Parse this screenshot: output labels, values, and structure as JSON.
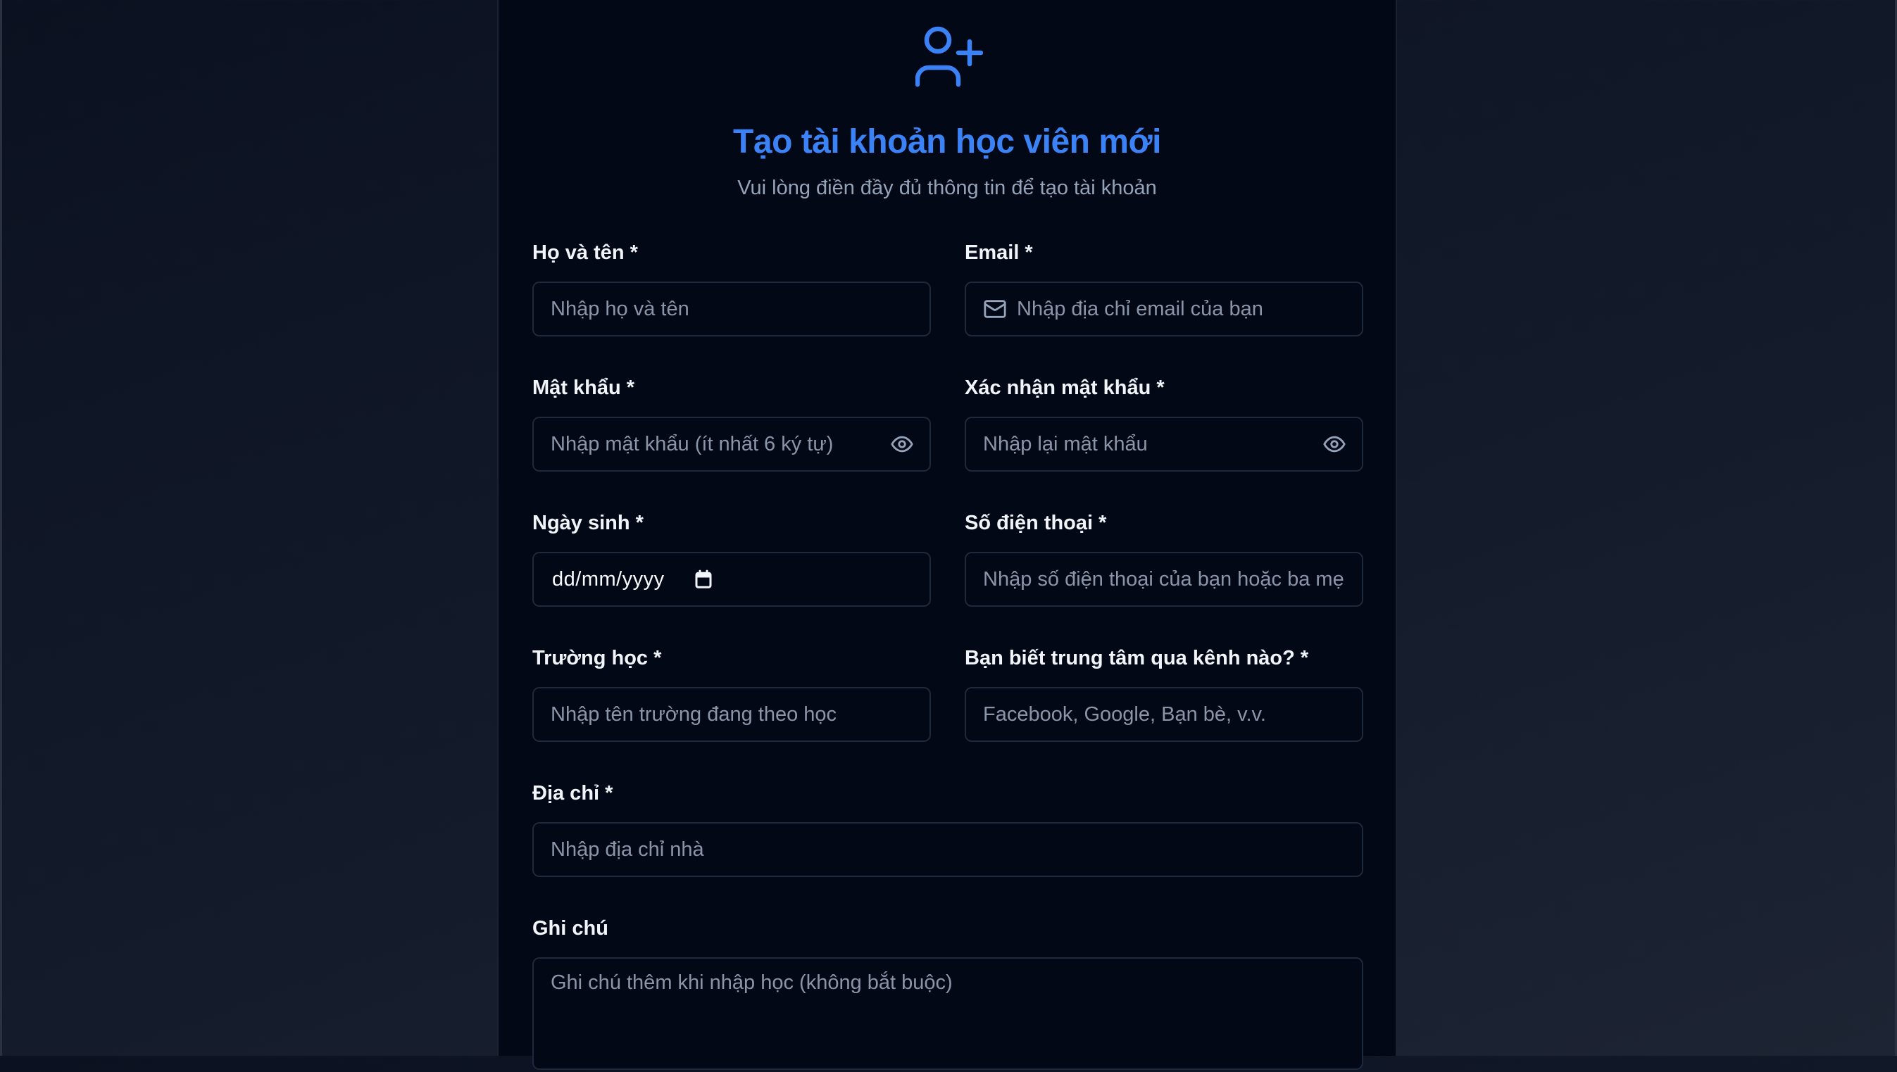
{
  "form": {
    "title": "Tạo tài khoản học viên mới",
    "subtitle": "Vui lòng điền đầy đủ thông tin để tạo tài khoản",
    "header_icon": "user-plus-icon",
    "accent_color": "#3b82f6",
    "fields": {
      "full_name": {
        "label": "Họ và tên *",
        "placeholder": "Nhập họ và tên",
        "value": ""
      },
      "email": {
        "label": "Email *",
        "placeholder": "Nhập địa chỉ email của bạn",
        "value": "",
        "icon": "mail-icon"
      },
      "password": {
        "label": "Mật khẩu *",
        "placeholder": "Nhập mật khẩu (ít nhất 6 ký tự)",
        "value": "",
        "icon": "eye-icon"
      },
      "confirm_password": {
        "label": "Xác nhận mật khẩu *",
        "placeholder": "Nhập lại mật khẩu",
        "value": "",
        "icon": "eye-icon"
      },
      "birth_date": {
        "label": "Ngày sinh *",
        "display": "dd/mm/yyyy",
        "icon": "calendar-icon"
      },
      "phone": {
        "label": "Số điện thoại *",
        "placeholder": "Nhập số điện thoại của bạn hoặc ba mẹ",
        "value": ""
      },
      "school": {
        "label": "Trường học *",
        "placeholder": "Nhập tên trường đang theo học",
        "value": ""
      },
      "referral": {
        "label": "Bạn biết trung tâm qua kênh nào? *",
        "placeholder": "Facebook, Google, Bạn bè, v.v.",
        "value": ""
      },
      "address": {
        "label": "Địa chỉ *",
        "placeholder": "Nhập địa chỉ nhà",
        "value": ""
      },
      "note": {
        "label": "Ghi chú",
        "placeholder": "Ghi chú thêm khi nhập học (không bắt buộc)",
        "value": ""
      }
    }
  }
}
